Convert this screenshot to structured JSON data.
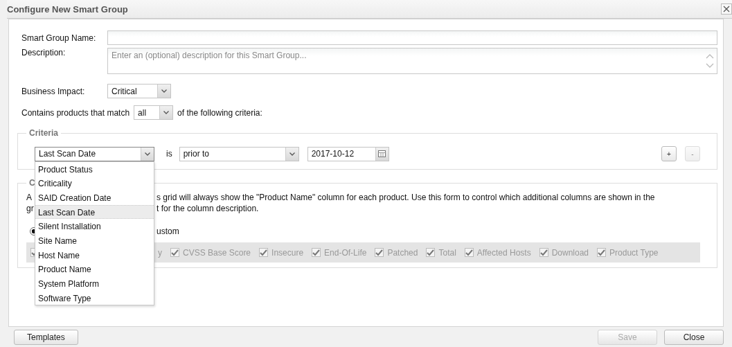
{
  "window": {
    "title": "Configure New Smart Group"
  },
  "form": {
    "name": {
      "label": "Smart Group Name:"
    },
    "description": {
      "label": "Description:",
      "placeholder": "Enter an (optional) description for this Smart Group..."
    },
    "business_impact": {
      "label": "Business Impact:",
      "value": "Critical"
    },
    "match": {
      "prefix": "Contains products that match",
      "value": "all",
      "suffix": "of the following criteria:"
    }
  },
  "criteria": {
    "legend": "Criteria",
    "field": "Last Scan Date",
    "operator_label": "is",
    "operator": "prior to",
    "date": "2017-10-12",
    "add_button": {
      "label": "+",
      "disabled": false
    },
    "remove_button": {
      "label": "-",
      "disabled": true
    },
    "dropdown": [
      {
        "label": "Product Status",
        "selected": false
      },
      {
        "label": "Criticality",
        "selected": false
      },
      {
        "label": "SAID Creation Date",
        "selected": false
      },
      {
        "label": "Last Scan Date",
        "selected": true
      },
      {
        "label": "Silent Installation",
        "selected": false
      },
      {
        "label": "Site Name",
        "selected": false
      },
      {
        "label": "Host Name",
        "selected": false
      },
      {
        "label": "Product Name",
        "selected": false
      },
      {
        "label": "System Platform",
        "selected": false
      },
      {
        "label": "Software Type",
        "selected": false
      }
    ]
  },
  "columns_section": {
    "legend": "C",
    "lines": [
      {
        "left": "A",
        "right": "s grid will always show the \"Product Name\" column for each product. Use this form to control which additional columns are shown in the"
      },
      {
        "left": "gr",
        "right": "t for the column description."
      }
    ],
    "radio": {
      "checked": true
    },
    "radio_label_fragment": "ustom",
    "partial_checkbox": {
      "checked": true
    },
    "label_fragment": "y",
    "checkboxes": [
      {
        "label": "CVSS Base Score",
        "checked": true,
        "disabled": true
      },
      {
        "label": "Insecure",
        "checked": true,
        "disabled": true
      },
      {
        "label": "End-Of-Life",
        "checked": true,
        "disabled": true
      },
      {
        "label": "Patched",
        "checked": true,
        "disabled": true
      },
      {
        "label": "Total",
        "checked": true,
        "disabled": true
      },
      {
        "label": "Affected Hosts",
        "checked": true,
        "disabled": true
      },
      {
        "label": "Download",
        "checked": true,
        "disabled": true
      },
      {
        "label": "Product Type",
        "checked": true,
        "disabled": true
      }
    ]
  },
  "footer": {
    "templates_button": {
      "label": "Templates",
      "disabled": false
    },
    "buttons": [
      {
        "label": "Save",
        "disabled": true
      },
      {
        "label": "Close",
        "disabled": false
      }
    ]
  }
}
